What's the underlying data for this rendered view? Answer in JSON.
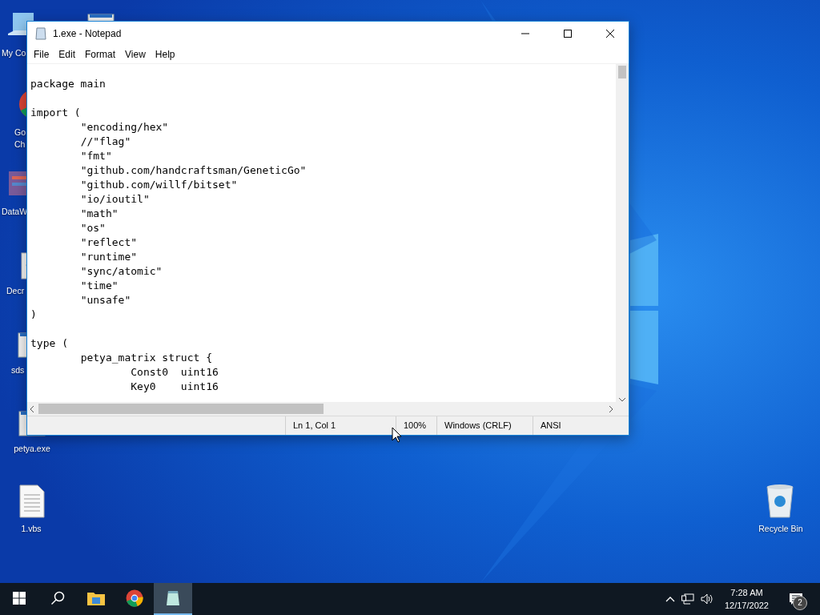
{
  "desktop_icons": [
    {
      "kind": "computer",
      "label_lines": [
        "My Co"
      ]
    },
    {
      "kind": "app-window"
    },
    {
      "kind": "chrome",
      "label_lines": [
        "Go",
        "Ch"
      ]
    },
    {
      "kind": "data",
      "label_lines": [
        "DataW"
      ]
    },
    {
      "kind": "gear-doc",
      "label_lines": [
        "Decr"
      ]
    },
    {
      "kind": "app-window",
      "label_lines": [
        "sds"
      ]
    },
    {
      "kind": "app-window",
      "label_lines": [
        "petya.exe"
      ]
    },
    {
      "kind": "text-doc",
      "label_lines": [
        "1.vbs"
      ]
    },
    {
      "kind": "recycle",
      "label_lines": [
        "Recycle Bin"
      ]
    }
  ],
  "window": {
    "title": "1.exe - Notepad",
    "menu": [
      "File",
      "Edit",
      "Format",
      "View",
      "Help"
    ],
    "paragraphs": [
      [
        "package main"
      ],
      [
        "import (",
        "\t\"encoding/hex\"",
        "\t//\"flag\"",
        "\t\"fmt\"",
        "\t\"github.com/handcraftsman/GeneticGo\"",
        "\t\"github.com/willf/bitset\"",
        "\t\"io/ioutil\"",
        "\t\"math\"",
        "\t\"os\"",
        "\t\"reflect\"",
        "\t\"runtime\"",
        "\t\"sync/atomic\"",
        "\t\"time\"",
        "\t\"unsafe\"",
        ")"
      ],
      [
        "type (",
        "\tpetya_matrix struct {",
        "\t\tConst0  uint16",
        "\t\tKey0    uint16"
      ]
    ],
    "status": [
      "Ln 1, Col 1",
      "100%",
      "Windows (CRLF)",
      "ANSI"
    ]
  },
  "taskbar": {
    "apps": [
      {
        "kind": "start",
        "selected": false
      },
      {
        "kind": "search",
        "selected": false
      },
      {
        "kind": "explorer",
        "selected": false
      },
      {
        "kind": "chrome",
        "selected": false
      },
      {
        "kind": "notepad",
        "selected": true
      }
    ],
    "time": "7:28 AM",
    "date": "12/17/2022",
    "notification_count": "2"
  }
}
